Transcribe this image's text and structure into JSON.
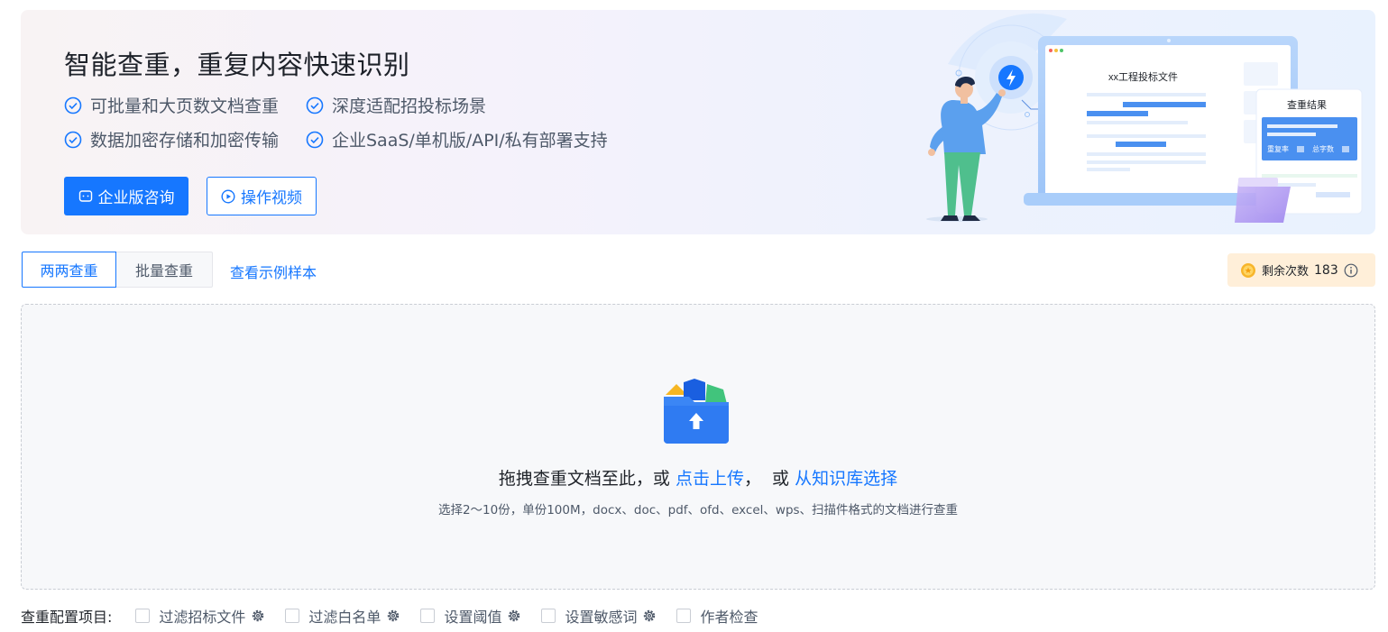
{
  "banner": {
    "title": "智能查重，重复内容快速识别",
    "features": [
      "可批量和大页数文档查重",
      "深度适配招投标场景",
      "数据加密存储和加密传输",
      "企业SaaS/单机版/API/私有部署支持"
    ],
    "consult_button": "企业版咨询",
    "video_button": "操作视频",
    "illustration": {
      "doc_title": "xx工程投标文件",
      "result_title": "查重结果",
      "result_rate": "重复率",
      "result_words": "总字数"
    }
  },
  "tabs": [
    {
      "label": "两两查重",
      "active": true
    },
    {
      "label": "批量查重",
      "active": false
    }
  ],
  "sample_link": "查看示例样本",
  "remaining": {
    "label": "剩余次数",
    "count": "183"
  },
  "dropzone": {
    "prefix": "拖拽查重文档至此，或 ",
    "upload_link": "点击上传",
    "middle": "，  或 ",
    "kb_link": "从知识库选择",
    "hint": "选择2～10份，单份100M，docx、doc、pdf、ofd、excel、wps、扫描件格式的文档进行查重"
  },
  "config": {
    "label": "查重配置项目:",
    "options": [
      {
        "label": "过滤招标文件",
        "gear": true
      },
      {
        "label": "过滤白名单",
        "gear": true
      },
      {
        "label": "设置阈值",
        "gear": true
      },
      {
        "label": "设置敏感词",
        "gear": true
      },
      {
        "label": "作者检查",
        "gear": false
      }
    ]
  },
  "colors": {
    "primary": "#1677ff",
    "remain_bg": "#ffefd9",
    "dropzone_bg": "#f7f8fa"
  }
}
